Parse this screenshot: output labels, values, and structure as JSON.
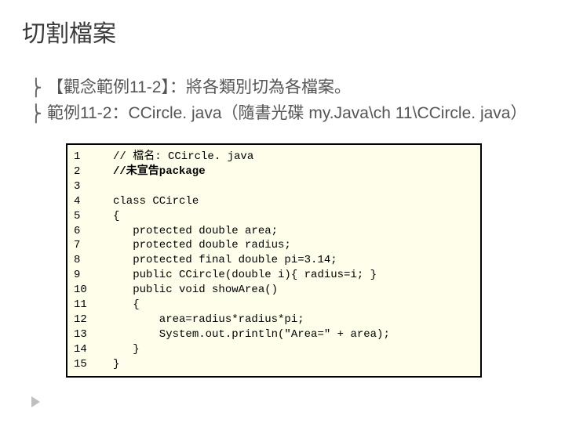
{
  "title": "切割檔案",
  "bullets": [
    "【觀念範例11-2】：將各類別切為各檔案。",
    "範例11-2：CCircle. java（隨書光碟 my.Java\\ch 11\\CCircle. java）"
  ],
  "bullet_mark": "⎬",
  "code": {
    "lines": [
      {
        "num": "1",
        "text": "// 檔名: CCircle. java",
        "bold": false
      },
      {
        "num": "2",
        "text": "//未宣告package",
        "bold": true
      },
      {
        "num": "3",
        "text": "",
        "bold": false
      },
      {
        "num": "4",
        "text": "class CCircle",
        "bold": false
      },
      {
        "num": "5",
        "text": "{",
        "bold": false
      },
      {
        "num": "6",
        "text": "   protected double area;",
        "bold": false
      },
      {
        "num": "7",
        "text": "   protected double radius;",
        "bold": false
      },
      {
        "num": "8",
        "text": "   protected final double pi=3.14;",
        "bold": false
      },
      {
        "num": "9",
        "text": "   public CCircle(double i){ radius=i; }",
        "bold": false
      },
      {
        "num": "10",
        "text": "   public void showArea()",
        "bold": false
      },
      {
        "num": "11",
        "text": "   {",
        "bold": false
      },
      {
        "num": "12",
        "text": "       area=radius*radius*pi;",
        "bold": false
      },
      {
        "num": "13",
        "text": "       System.out.println(\"Area=\" + area);",
        "bold": false
      },
      {
        "num": "14",
        "text": "   }",
        "bold": false
      },
      {
        "num": "15",
        "text": "}",
        "bold": false
      }
    ]
  }
}
